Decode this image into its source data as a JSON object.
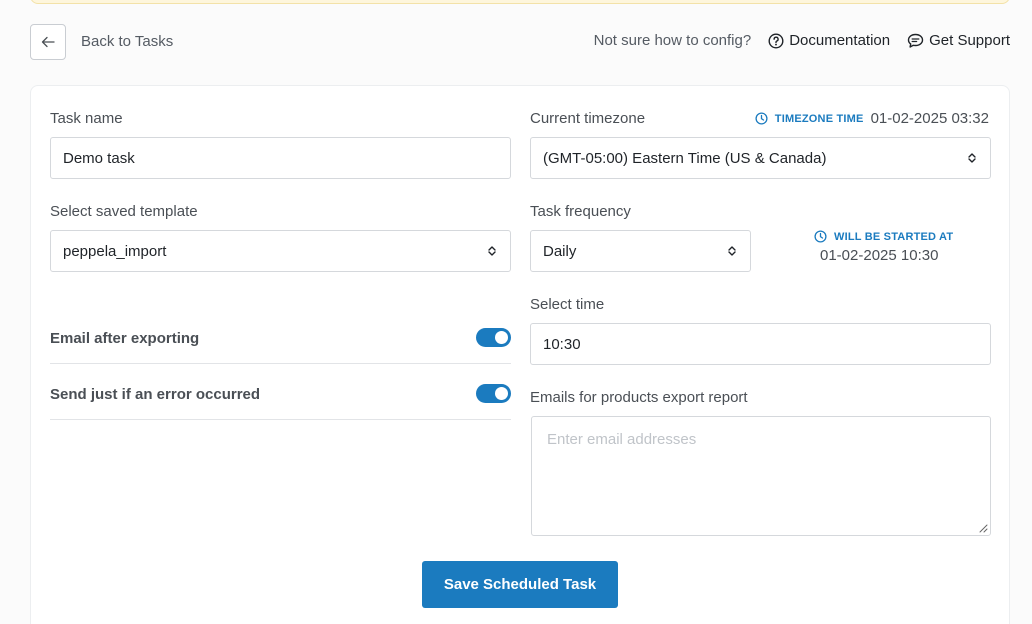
{
  "header": {
    "back_label": "Back to Tasks",
    "hint": "Not sure how to config?",
    "documentation": "Documentation",
    "support": "Get Support"
  },
  "form": {
    "task_name": {
      "label": "Task name",
      "value": "Demo task"
    },
    "timezone": {
      "label": "Current timezone",
      "meta_label": "TIMEZONE TIME",
      "meta_value": "01-02-2025 03:32",
      "value": "(GMT-05:00) Eastern Time (US & Canada)"
    },
    "template": {
      "label": "Select saved template",
      "value": "peppela_import"
    },
    "frequency": {
      "label": "Task frequency",
      "value": "Daily"
    },
    "start": {
      "label": "WILL BE STARTED AT",
      "value": "01-02-2025 10:30"
    },
    "time": {
      "label": "Select time",
      "value": "10:30"
    },
    "email_after": {
      "label": "Email after exporting",
      "enabled": true
    },
    "error_only": {
      "label": "Send just if an error occurred",
      "enabled": true
    },
    "emails": {
      "label": "Emails for products export report",
      "placeholder": "Enter email addresses"
    },
    "save_label": "Save Scheduled Task"
  },
  "colors": {
    "accent": "#1b7bbf",
    "banner": "#fef6dc"
  }
}
